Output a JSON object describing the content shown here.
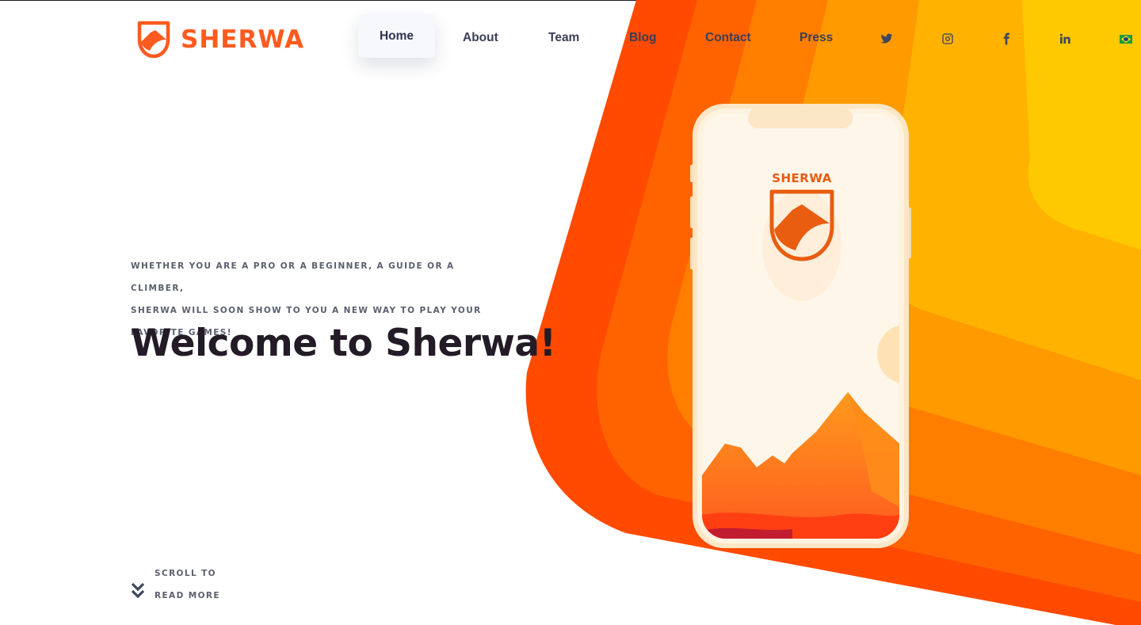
{
  "brand": {
    "name": "SHERWA",
    "color": "#ff5a1f"
  },
  "nav": {
    "items": [
      {
        "label": "Home",
        "active": true
      },
      {
        "label": "About",
        "active": false
      },
      {
        "label": "Team",
        "active": false
      },
      {
        "label": "Blog",
        "active": false
      },
      {
        "label": "Contact",
        "active": false
      },
      {
        "label": "Press",
        "active": false
      }
    ],
    "social_icons": [
      "twitter-icon",
      "instagram-icon",
      "facebook-icon",
      "linkedin-icon"
    ],
    "language_flag": "brazil-flag-icon"
  },
  "hero": {
    "eyebrow_lines": [
      "WHETHER YOU ARE A PRO OR A BEGINNER, A GUIDE OR A CLIMBER,",
      "SHERWA WILL SOON SHOW TO YOU A NEW WAY TO PLAY YOUR",
      "FAVORITE GAMES!"
    ],
    "title": "Welcome to Sherwa!"
  },
  "scroll": {
    "line1": "SCROLL TO",
    "line2": "READ MORE",
    "icon": "double-chevron-down-icon"
  },
  "phone_screen": {
    "app_name": "SHERWA"
  },
  "colors": {
    "band_1": "#ff4a00",
    "band_2": "#ff6300",
    "band_3": "#ff7e00",
    "band_4": "#ff9a00",
    "band_5": "#ffb300",
    "band_6": "#ffc900",
    "text_dark": "#231b25",
    "text_muted": "#5b5f6e"
  }
}
